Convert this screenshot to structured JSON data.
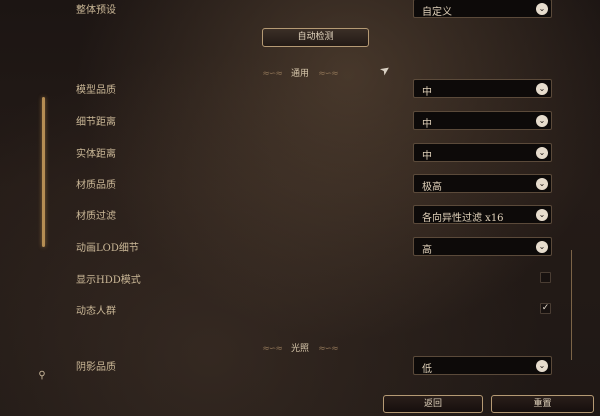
{
  "top_setting": {
    "label": "整体预设",
    "value": "自定义"
  },
  "auto_detect": {
    "label": "自动检测"
  },
  "sections": {
    "general": {
      "title": "通用",
      "ornament_left": "≈∽≈",
      "ornament_right": "≈∽≈"
    },
    "lighting": {
      "title": "光照",
      "ornament_left": "≈∽≈",
      "ornament_right": "≈∽≈"
    }
  },
  "settings": [
    {
      "label": "模型品质",
      "value": "中"
    },
    {
      "label": "细节距离",
      "value": "中"
    },
    {
      "label": "实体距离",
      "value": "中"
    },
    {
      "label": "材质品质",
      "value": "极高"
    },
    {
      "label": "材质过滤",
      "value": "各向异性过滤 x16"
    },
    {
      "label": "动画LOD细节",
      "value": "高"
    },
    {
      "label": "显示HDD模式",
      "checked": false
    },
    {
      "label": "动态人群",
      "checked": true
    },
    {
      "label": "阴影品质",
      "value": "低"
    }
  ],
  "icons": {
    "dropdown": "⌄",
    "check": "✓",
    "cursor": "➤",
    "left_icon": "⚲"
  },
  "footer": {
    "back_label": "返回",
    "reset_label": "重置"
  }
}
